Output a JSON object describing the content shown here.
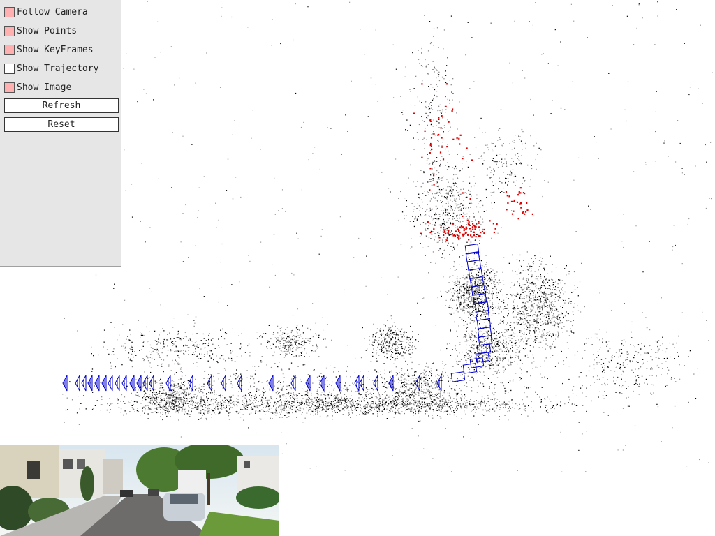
{
  "panel": {
    "checkboxes": [
      {
        "label": "Follow Camera",
        "checked": true
      },
      {
        "label": "Show Points",
        "checked": true
      },
      {
        "label": "Show KeyFrames",
        "checked": true
      },
      {
        "label": "Show Trajectory",
        "checked": false
      },
      {
        "label": "Show Image",
        "checked": true
      }
    ],
    "buttons": {
      "refresh": "Refresh",
      "reset": "Reset"
    }
  },
  "colors": {
    "map_points": "#000000",
    "reference_points": "#dd0000",
    "keyframes": "#0000cc",
    "panel_bg": "#e6e6e6",
    "checkbox_on": "#ffb0b0"
  }
}
